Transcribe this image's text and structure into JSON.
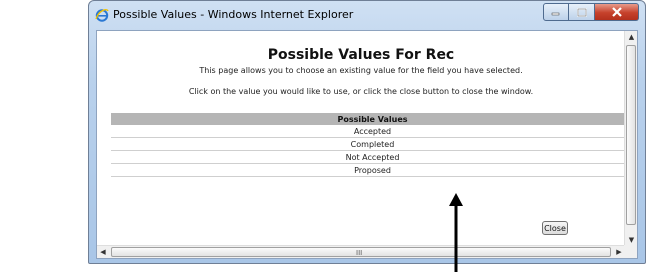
{
  "window": {
    "title": "Possible Values - Windows Internet Explorer"
  },
  "page": {
    "title": "Possible Values For Rec",
    "subtitle": "This page allows you to choose an existing value for the field you have selected.",
    "instruction": "Click on the value you would like to use, or click the close button to close the window."
  },
  "table": {
    "header": "Possible Values",
    "rows": [
      "Accepted",
      "Completed",
      "Not Accepted",
      "Proposed"
    ]
  },
  "buttons": {
    "close_label": "Close"
  },
  "scrollbar": {
    "grip": "III"
  },
  "colors": {
    "titlebar": "#b9d1ec",
    "table_header": "#b5b5b5",
    "close_caption": "#c6412b"
  }
}
